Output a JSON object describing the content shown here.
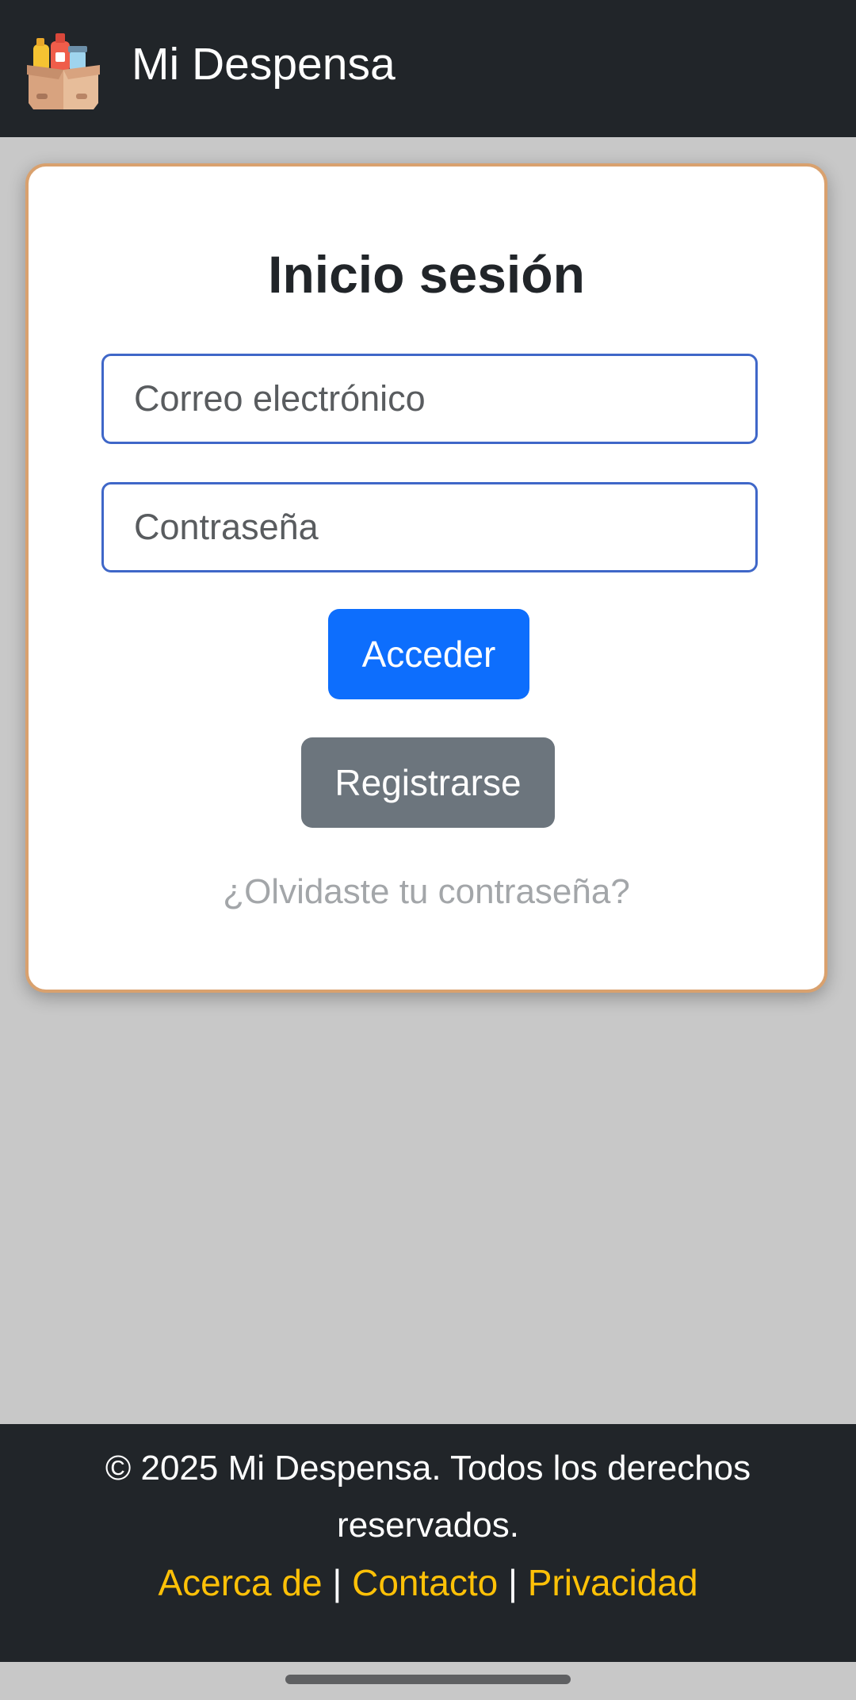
{
  "navbar": {
    "title": "Mi Despensa",
    "logo_icon": "pantry-box-icon"
  },
  "login": {
    "heading": "Inicio sesión",
    "email_placeholder": "Correo electrónico",
    "email_value": "",
    "password_placeholder": "Contraseña",
    "password_value": "",
    "submit_label": "Acceder",
    "register_label": "Registrarse",
    "forgot_label": "¿Olvidaste tu contraseña?"
  },
  "footer": {
    "copyright": "© 2025 Mi Despensa. Todos los derechos reservados.",
    "links": [
      "Acerca de",
      "Contacto",
      "Privacidad"
    ],
    "separator": "|"
  },
  "colors": {
    "navbar_bg": "#212529",
    "page_bg": "#c8c8c8",
    "card_border": "#d9a16e",
    "input_border": "#3f67c8",
    "primary": "#0d6efd",
    "secondary": "#6c757d",
    "footer_link": "#ffc107"
  }
}
